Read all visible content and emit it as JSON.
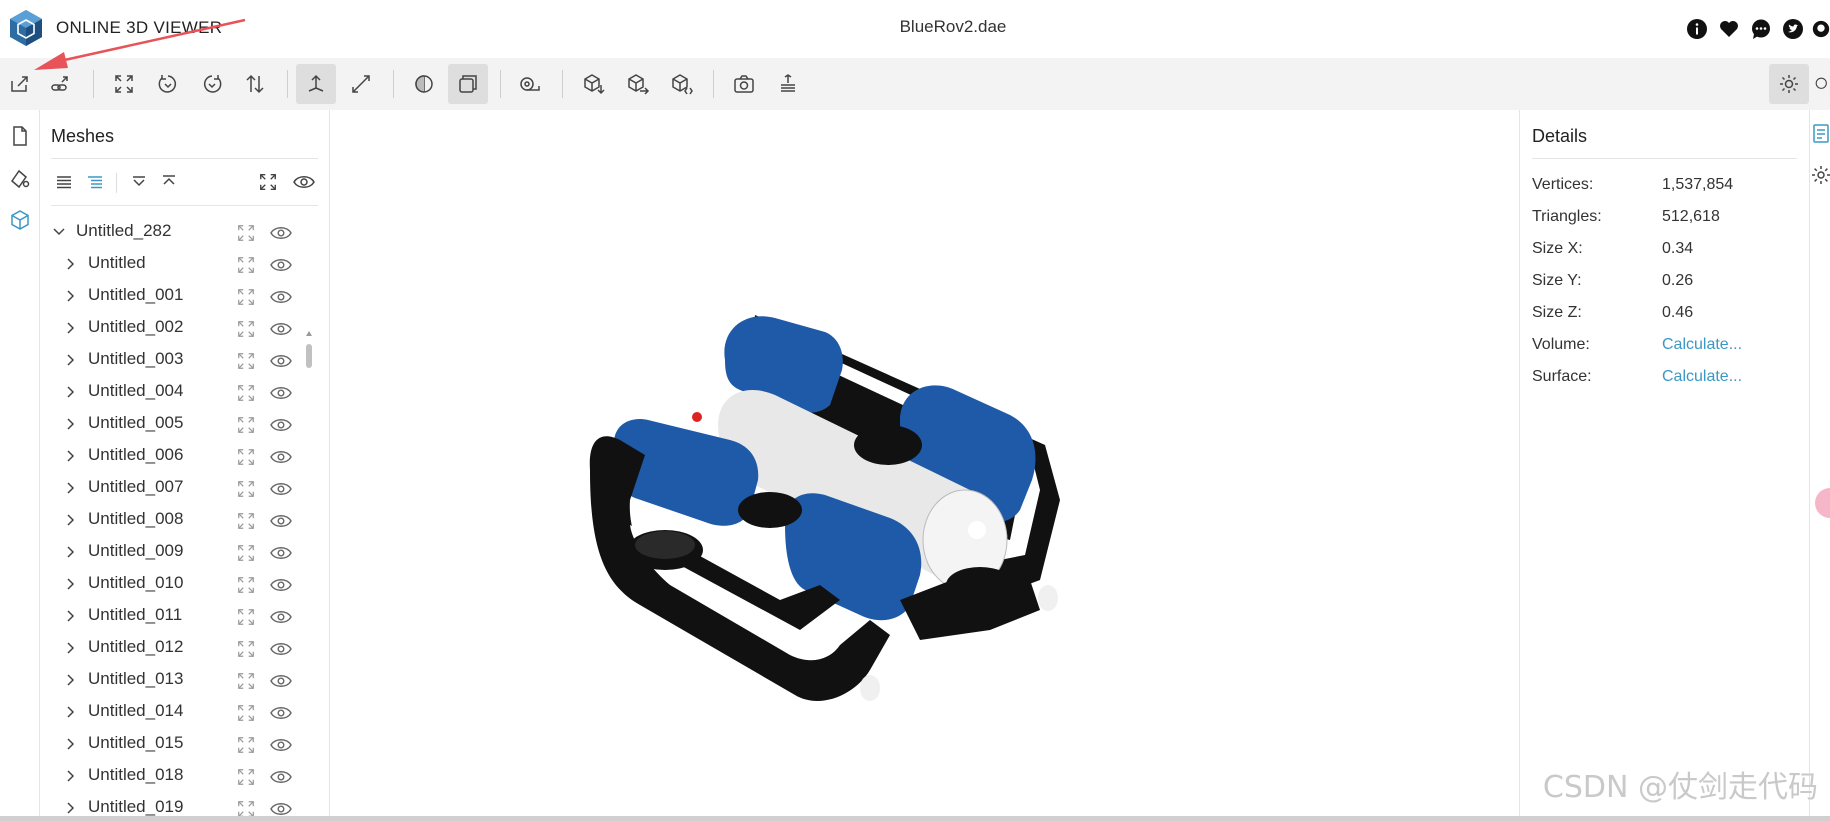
{
  "header": {
    "app_title": "ONLINE 3D VIEWER",
    "file_name": "BlueRov2.dae",
    "icons": [
      "info-icon",
      "heart-icon",
      "comment-icon",
      "twitter-icon",
      "github-icon"
    ]
  },
  "toolbar": {
    "buttons": [
      "open-file",
      "open-url",
      "fit-to-window",
      "rotate-left",
      "rotate-right",
      "flip-up",
      "fixed-up-vector",
      "free-orbit",
      "edges",
      "shading",
      "measure",
      "export-down",
      "export-right",
      "export-model",
      "snapshot",
      "import-settings"
    ],
    "active": [
      "fixed-up-vector",
      "shading"
    ],
    "right": [
      "theme-toggle"
    ]
  },
  "left_rail": [
    "file-icon",
    "materials-icon",
    "meshes-icon"
  ],
  "meshes": {
    "title": "Meshes",
    "root": "Untitled_282",
    "items": [
      "Untitled",
      "Untitled_001",
      "Untitled_002",
      "Untitled_003",
      "Untitled_004",
      "Untitled_005",
      "Untitled_006",
      "Untitled_007",
      "Untitled_008",
      "Untitled_009",
      "Untitled_010",
      "Untitled_011",
      "Untitled_012",
      "Untitled_013",
      "Untitled_014",
      "Untitled_015",
      "Untitled_018",
      "Untitled_019"
    ]
  },
  "details": {
    "title": "Details",
    "rows": [
      {
        "label": "Vertices:",
        "value": "1,537,854"
      },
      {
        "label": "Triangles:",
        "value": "512,618"
      },
      {
        "label": "Size X:",
        "value": "0.34"
      },
      {
        "label": "Size Y:",
        "value": "0.26"
      },
      {
        "label": "Size Z:",
        "value": "0.46"
      },
      {
        "label": "Volume:",
        "value": "Calculate..."
      },
      {
        "label": "Surface:",
        "value": "Calculate..."
      }
    ]
  },
  "colors": {
    "accent": "#3b98c4",
    "rov_blue": "#1f5aa8",
    "annotation": "#e8535a"
  },
  "watermark": "CSDN @仗剑走代码"
}
